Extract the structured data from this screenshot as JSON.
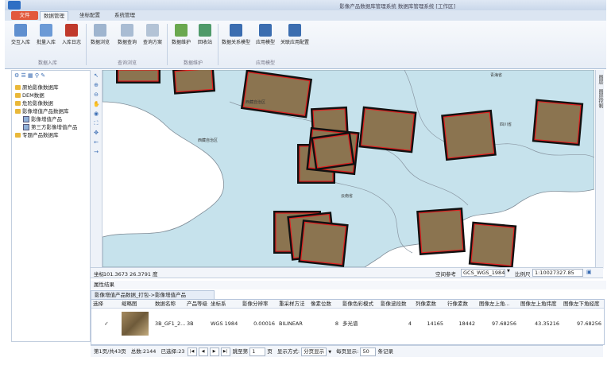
{
  "window": {
    "title": "影像产品数据库管理系统 数据库管理系统 [工作区]"
  },
  "tabs": [
    {
      "label": "文件"
    },
    {
      "label": "数据管理"
    },
    {
      "label": "坐标配置"
    },
    {
      "label": "系统管理"
    }
  ],
  "ribbon": {
    "buttons": [
      {
        "label": "交互入库",
        "icon": "import-interactive-icon"
      },
      {
        "label": "批量入库",
        "icon": "import-batch-icon"
      },
      {
        "label": "入库日志",
        "icon": "log-icon"
      },
      {
        "label": "数据浏览",
        "icon": "browse-icon"
      },
      {
        "label": "数据查询",
        "icon": "query-icon"
      },
      {
        "label": "查询方案",
        "icon": "scheme-icon"
      },
      {
        "label": "数据维护",
        "icon": "edit-icon"
      },
      {
        "label": "回收站",
        "icon": "recycle-icon"
      },
      {
        "label": "数据关系模型",
        "icon": "model-icon"
      },
      {
        "label": "应用模型",
        "icon": "app-model-icon"
      },
      {
        "label": "关联应用配置",
        "icon": "config-icon"
      }
    ],
    "groups": [
      "数据入库",
      "查询浏览",
      "数据维护",
      "应用模型"
    ]
  },
  "tree": {
    "items": [
      {
        "label": "原始影像数据库",
        "level": 0
      },
      {
        "label": "DEM数据",
        "level": 0
      },
      {
        "label": "危险影像数据",
        "level": 0
      },
      {
        "label": "影像增值产品数据库",
        "level": 0
      },
      {
        "label": "影像增值产品",
        "level": 1
      },
      {
        "label": "第三方影像增值产品",
        "level": 1
      },
      {
        "label": "专题产品数据库",
        "level": 0
      }
    ]
  },
  "map": {
    "labels": [
      "西藏自治区",
      "西藏自治区",
      "青海省",
      "四川省",
      "云南省"
    ],
    "water_color": "#c6e2ec",
    "land_color": "#ffffff",
    "footprint_color": "#e02020"
  },
  "right_strip": {
    "items": [
      "图层",
      "图层控制"
    ]
  },
  "status": {
    "coord_label": "坐标",
    "coord_value": "101.3673  26.3791 度",
    "crs_label": "空间参考",
    "crs_value": "GCS_WGS_1984",
    "scale_label": "比例尺",
    "scale_value": "1:10027327.85"
  },
  "results": {
    "header": "属性结果",
    "tab": "影像增值产品数据_打包->影像增值产品",
    "columns": [
      "选择",
      "缩略图",
      "数据名称",
      "产品等级",
      "坐标系",
      "影像分辨率",
      "重采样方法",
      "像素位数",
      "影像色彩模式",
      "影像波段数",
      "列像素数",
      "行像素数",
      "图像左上角...",
      "图像左上角纬度",
      "图像左下角经度"
    ],
    "row": {
      "checked": "✓",
      "name": "3B_GF1_2...",
      "level": "3B",
      "crs": "WGS 1984",
      "resolution": "0.00016",
      "resample": "BILINEAR",
      "bits": "8",
      "color_mode": "多光谱",
      "bands": "4",
      "cols": "14165",
      "rows": "18442",
      "ul_lon": "97.68256",
      "ul_lat": "43.35216",
      "ll_lon": "97.68256"
    }
  },
  "pager": {
    "page": "第1页/共43页",
    "total": "总数:2144",
    "selected": "已选择:23",
    "goto_label": "跳至第",
    "goto_value": "1",
    "page_unit": "页",
    "mode_label": "显示方式:",
    "mode_value": "分页显示",
    "per_page_label": "每页显示:",
    "per_page_value": "50",
    "records": "条记录"
  }
}
